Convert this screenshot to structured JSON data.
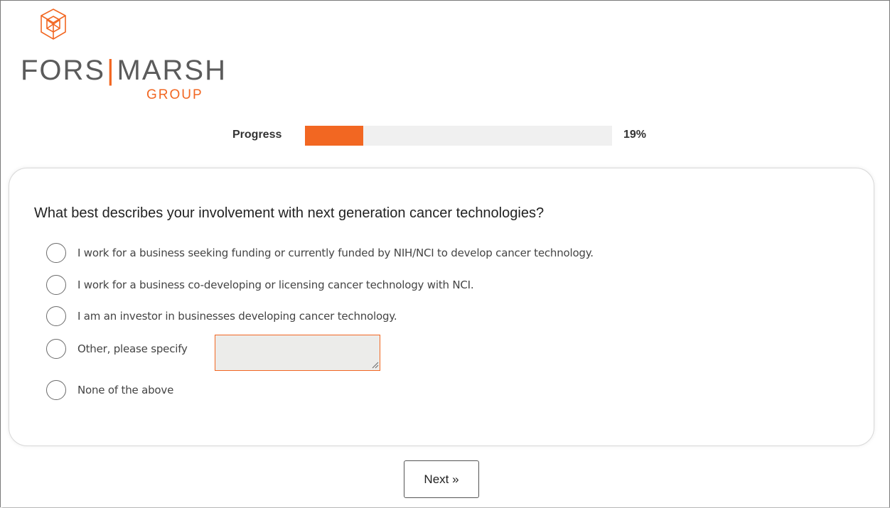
{
  "brand": {
    "name_left": "FORS",
    "separator": "|",
    "name_right": "MARSH",
    "sub": "GROUP",
    "accent": "#f26722",
    "icon": "cube-logo-icon"
  },
  "progress": {
    "label": "Progress",
    "percent_text": "19%",
    "value": 0.19
  },
  "question": {
    "text": "What best describes your involvement with next generation cancer technologies?",
    "options": [
      {
        "label": "I work for a business seeking funding or currently funded by NIH/NCI to develop cancer technology."
      },
      {
        "label": "I work for a business co-developing or licensing cancer technology with NCI."
      },
      {
        "label": "I am an investor in businesses developing cancer technology."
      },
      {
        "label": "Other, please specify"
      },
      {
        "label": "None of the above"
      }
    ],
    "other_value": ""
  },
  "next_button": "Next »"
}
